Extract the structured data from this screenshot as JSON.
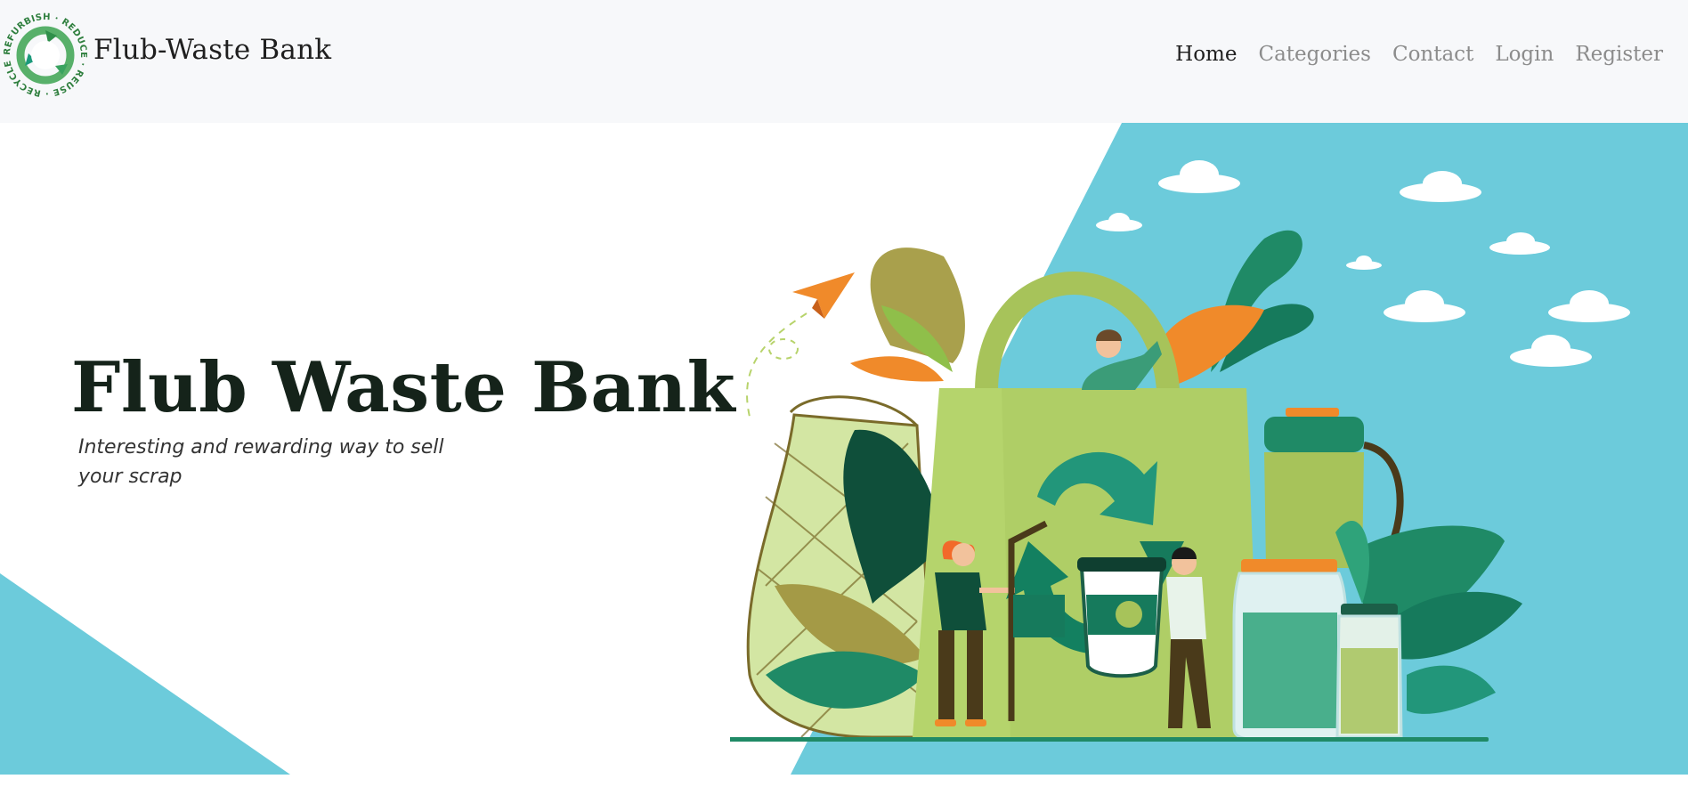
{
  "brand": {
    "name": "Flub-Waste Bank",
    "logo_ring_text": "REFURBISH · REDUCE · REUSE · RECYCLE ·",
    "logo_icon": "recycle-arrows-icon"
  },
  "nav": {
    "items": [
      {
        "label": "Home",
        "active": true
      },
      {
        "label": "Categories",
        "active": false
      },
      {
        "label": "Contact",
        "active": false
      },
      {
        "label": "Login",
        "active": false
      },
      {
        "label": "Register",
        "active": false
      }
    ]
  },
  "hero": {
    "title": "Flub Waste Bank",
    "subtitle": "Interesting and rewarding way to sell your scrap",
    "illustration": "eco-shopping-bag-recycle-illustration"
  },
  "colors": {
    "header_bg": "#f7f8fa",
    "accent_blue": "#6ccbdb",
    "title_text": "#15231a",
    "nav_inactive": "#8c8c8c",
    "nav_active": "#1f1f1f",
    "bag_green": "#b5d46c",
    "dark_green": "#167a5c"
  }
}
